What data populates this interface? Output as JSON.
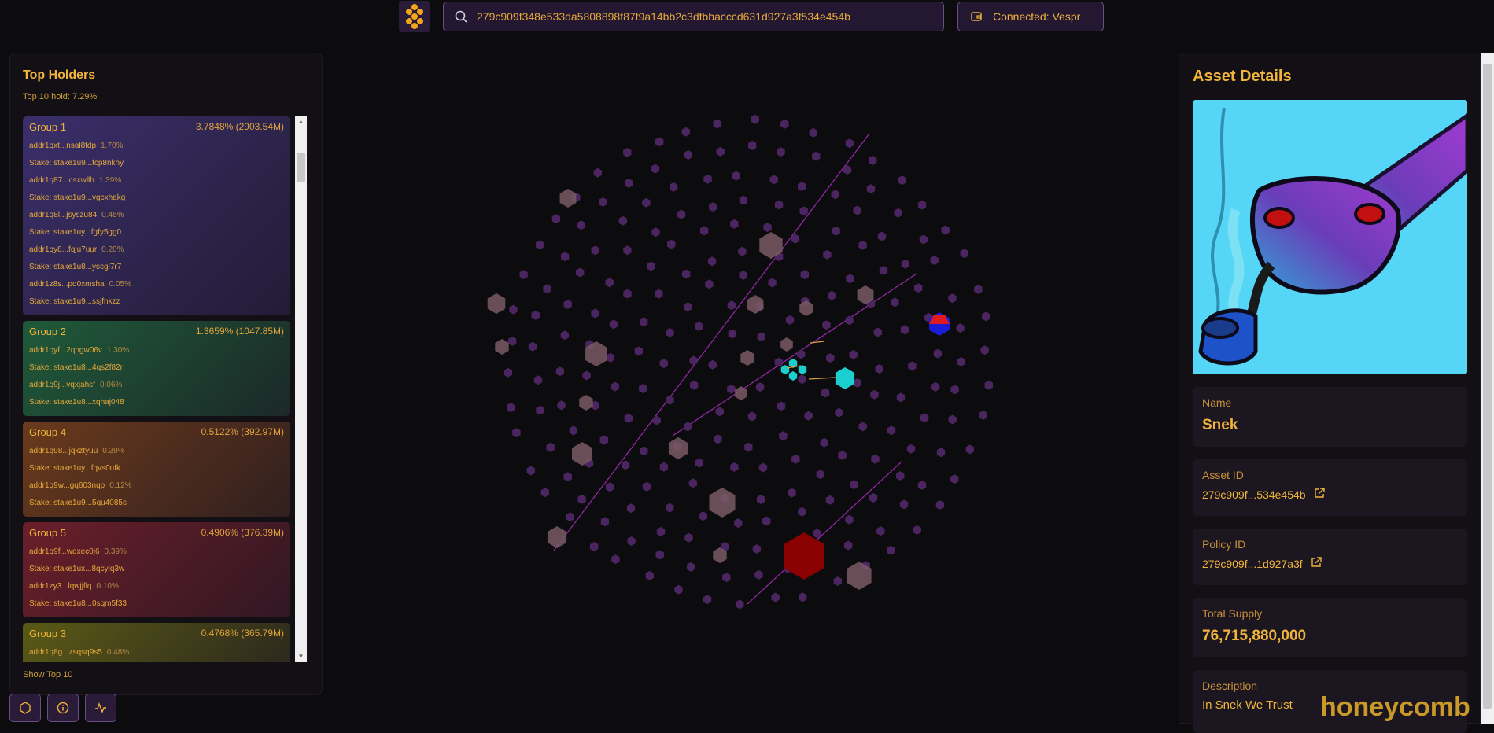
{
  "search": {
    "value": "279c909f348e533da5808898f87f9a14bb2c3dfbbacccd631d927a3f534e454b",
    "icon": "search-icon"
  },
  "wallet": {
    "label": "Connected: Vespr",
    "icon": "wallet-icon"
  },
  "holders": {
    "title": "Top Holders",
    "subtitle": "Top 10 hold: 7.29%",
    "show_top": "Show Top 10",
    "groups": [
      {
        "name": "Group 1",
        "pct": "3.7848% (2903.54M)",
        "color": "#3a2f6b",
        "rows": [
          {
            "addr": "addr1qxt...nsal8fdp",
            "pct": "1.70%",
            "stake": "Stake: stake1u9...fcp8nkhy"
          },
          {
            "addr": "addr1q87...csxwllh",
            "pct": "1.39%",
            "stake": "Stake: stake1u9...vgcxhakg"
          },
          {
            "addr": "addr1q8l...jsyszu84",
            "pct": "0.45%",
            "stake": "Stake: stake1uy...fgfy5gg0"
          },
          {
            "addr": "addr1qy8...fqju7uur",
            "pct": "0.20%",
            "stake": "Stake: stake1u8...yscgl7r7"
          },
          {
            "addr": "addr1z8s...pq0xmsha",
            "pct": "0.05%",
            "stake": "Stake: stake1u9...ssjfnkzz"
          }
        ]
      },
      {
        "name": "Group 2",
        "pct": "1.3659% (1047.85M)",
        "color": "#1f5a3a",
        "rows": [
          {
            "addr": "addr1qyf...2qngw06v",
            "pct": "1.30%",
            "stake": "Stake: stake1u8...4qs2f82r"
          },
          {
            "addr": "addr1q9j...vqxjahsf",
            "pct": "0.06%",
            "stake": "Stake: stake1u8...xqhaj048"
          }
        ]
      },
      {
        "name": "Group 4",
        "pct": "0.5122% (392.97M)",
        "color": "#6a3a1c",
        "rows": [
          {
            "addr": "addr1q98...jqxztyuu",
            "pct": "0.39%",
            "stake": "Stake: stake1uy...fqvs0ufk"
          },
          {
            "addr": "addr1q9w...gq603nqp",
            "pct": "0.12%",
            "stake": "Stake: stake1u9...5qu4085s"
          }
        ]
      },
      {
        "name": "Group 5",
        "pct": "0.4906% (376.39M)",
        "color": "#6a1f2a",
        "rows": [
          {
            "addr": "addr1q9f...wqxec0j6",
            "pct": "0.39%",
            "stake": "Stake: stake1ux...8qcylq3w"
          },
          {
            "addr": "addr1zy3...lqwjjflq",
            "pct": "0.10%",
            "stake": "Stake: stake1u8...0sqm5f33"
          }
        ]
      },
      {
        "name": "Group 3",
        "pct": "0.4768% (365.79M)",
        "color": "#5a5a16",
        "rows": [
          {
            "addr": "addr1q8g...zsqsq9s5",
            "pct": "0.48%",
            "stake": ""
          }
        ]
      }
    ]
  },
  "bottom_buttons": [
    {
      "icon": "hexagon-icon"
    },
    {
      "icon": "info-icon"
    },
    {
      "icon": "activity-icon"
    }
  ],
  "asset": {
    "title": "Asset Details",
    "name_label": "Name",
    "name": "Snek",
    "asset_id_label": "Asset ID",
    "asset_id": "279c909f...534e454b",
    "policy_id_label": "Policy ID",
    "policy_id": "279c909f...1d927a3f",
    "supply_label": "Total Supply",
    "supply": "76,715,880,000",
    "desc_label": "Description",
    "desc": "In Snek We Trust"
  },
  "brand": "honeycomb",
  "colors": {
    "accent": "#f0b43c",
    "panel": "#121014",
    "node": "#5b2e73",
    "edge": "#9b27b0",
    "highlight_cyan": "#1ccfcf",
    "highlight_red": "#8b0000"
  }
}
